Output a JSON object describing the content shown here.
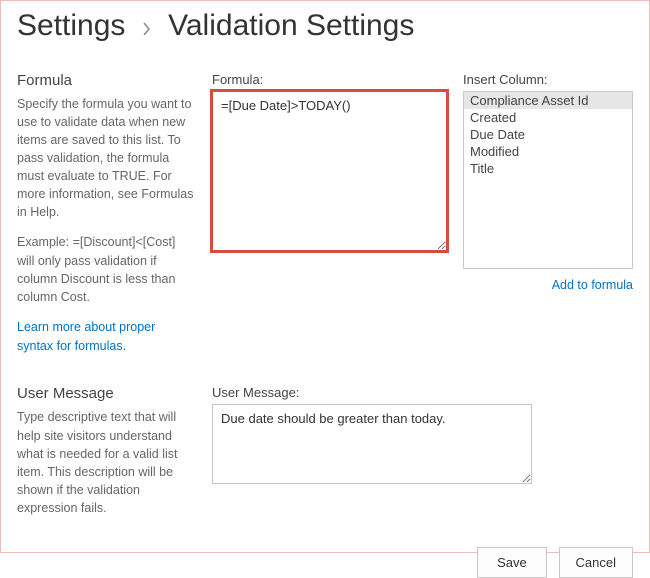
{
  "breadcrumb": {
    "parent": "Settings",
    "current": "Validation Settings"
  },
  "formulaSection": {
    "heading": "Formula",
    "description": "Specify the formula you want to use to validate data when new items are saved to this list. To pass validation, the formula must evaluate to TRUE. For more information, see Formulas in Help.",
    "example": "Example: =[Discount]<[Cost] will only pass validation if column Discount is less than column Cost.",
    "learnMoreLink": "Learn more about proper syntax for formulas.",
    "formulaLabel": "Formula:",
    "formulaValue": "=[Due Date]>TODAY()",
    "insertColumnLabel": "Insert Column:",
    "columns": [
      "Compliance Asset Id",
      "Created",
      "Due Date",
      "Modified",
      "Title"
    ],
    "selectedColumnIndex": 0,
    "addToFormulaLink": "Add to formula"
  },
  "userMessageSection": {
    "heading": "User Message",
    "description": "Type descriptive text that will help site visitors understand what is needed for a valid list item. This description will be shown if the validation expression fails.",
    "userMessageLabel": "User Message:",
    "userMessageValue": "Due date should be greater than today."
  },
  "buttons": {
    "save": "Save",
    "cancel": "Cancel"
  }
}
